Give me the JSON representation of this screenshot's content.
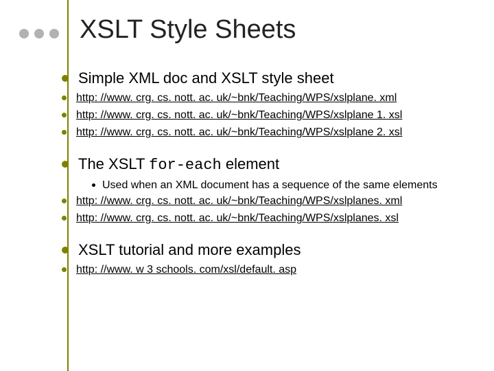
{
  "title": "XSLT Style Sheets",
  "section1": {
    "heading": "Simple XML doc and XSLT style sheet",
    "links": [
      "http: //www. crg. cs. nott. ac. uk/~bnk/Teaching/WPS/xslplane. xml",
      "http: //www. crg. cs. nott. ac. uk/~bnk/Teaching/WPS/xslplane 1. xsl",
      "http: //www. crg. cs. nott. ac. uk/~bnk/Teaching/WPS/xslplane 2. xsl"
    ]
  },
  "section2": {
    "heading_pre": "The XSLT ",
    "heading_code": "for-each",
    "heading_post": " element",
    "sub": "Used when an XML document has a sequence of the same elements",
    "links": [
      "http: //www. crg. cs. nott. ac. uk/~bnk/Teaching/WPS/xslplanes. xml",
      "http: //www. crg. cs. nott. ac. uk/~bnk/Teaching/WPS/xslplanes. xsl"
    ]
  },
  "section3": {
    "heading": "XSLT tutorial and more examples",
    "links": [
      "http: //www. w 3 schools. com/xsl/default. asp"
    ]
  }
}
